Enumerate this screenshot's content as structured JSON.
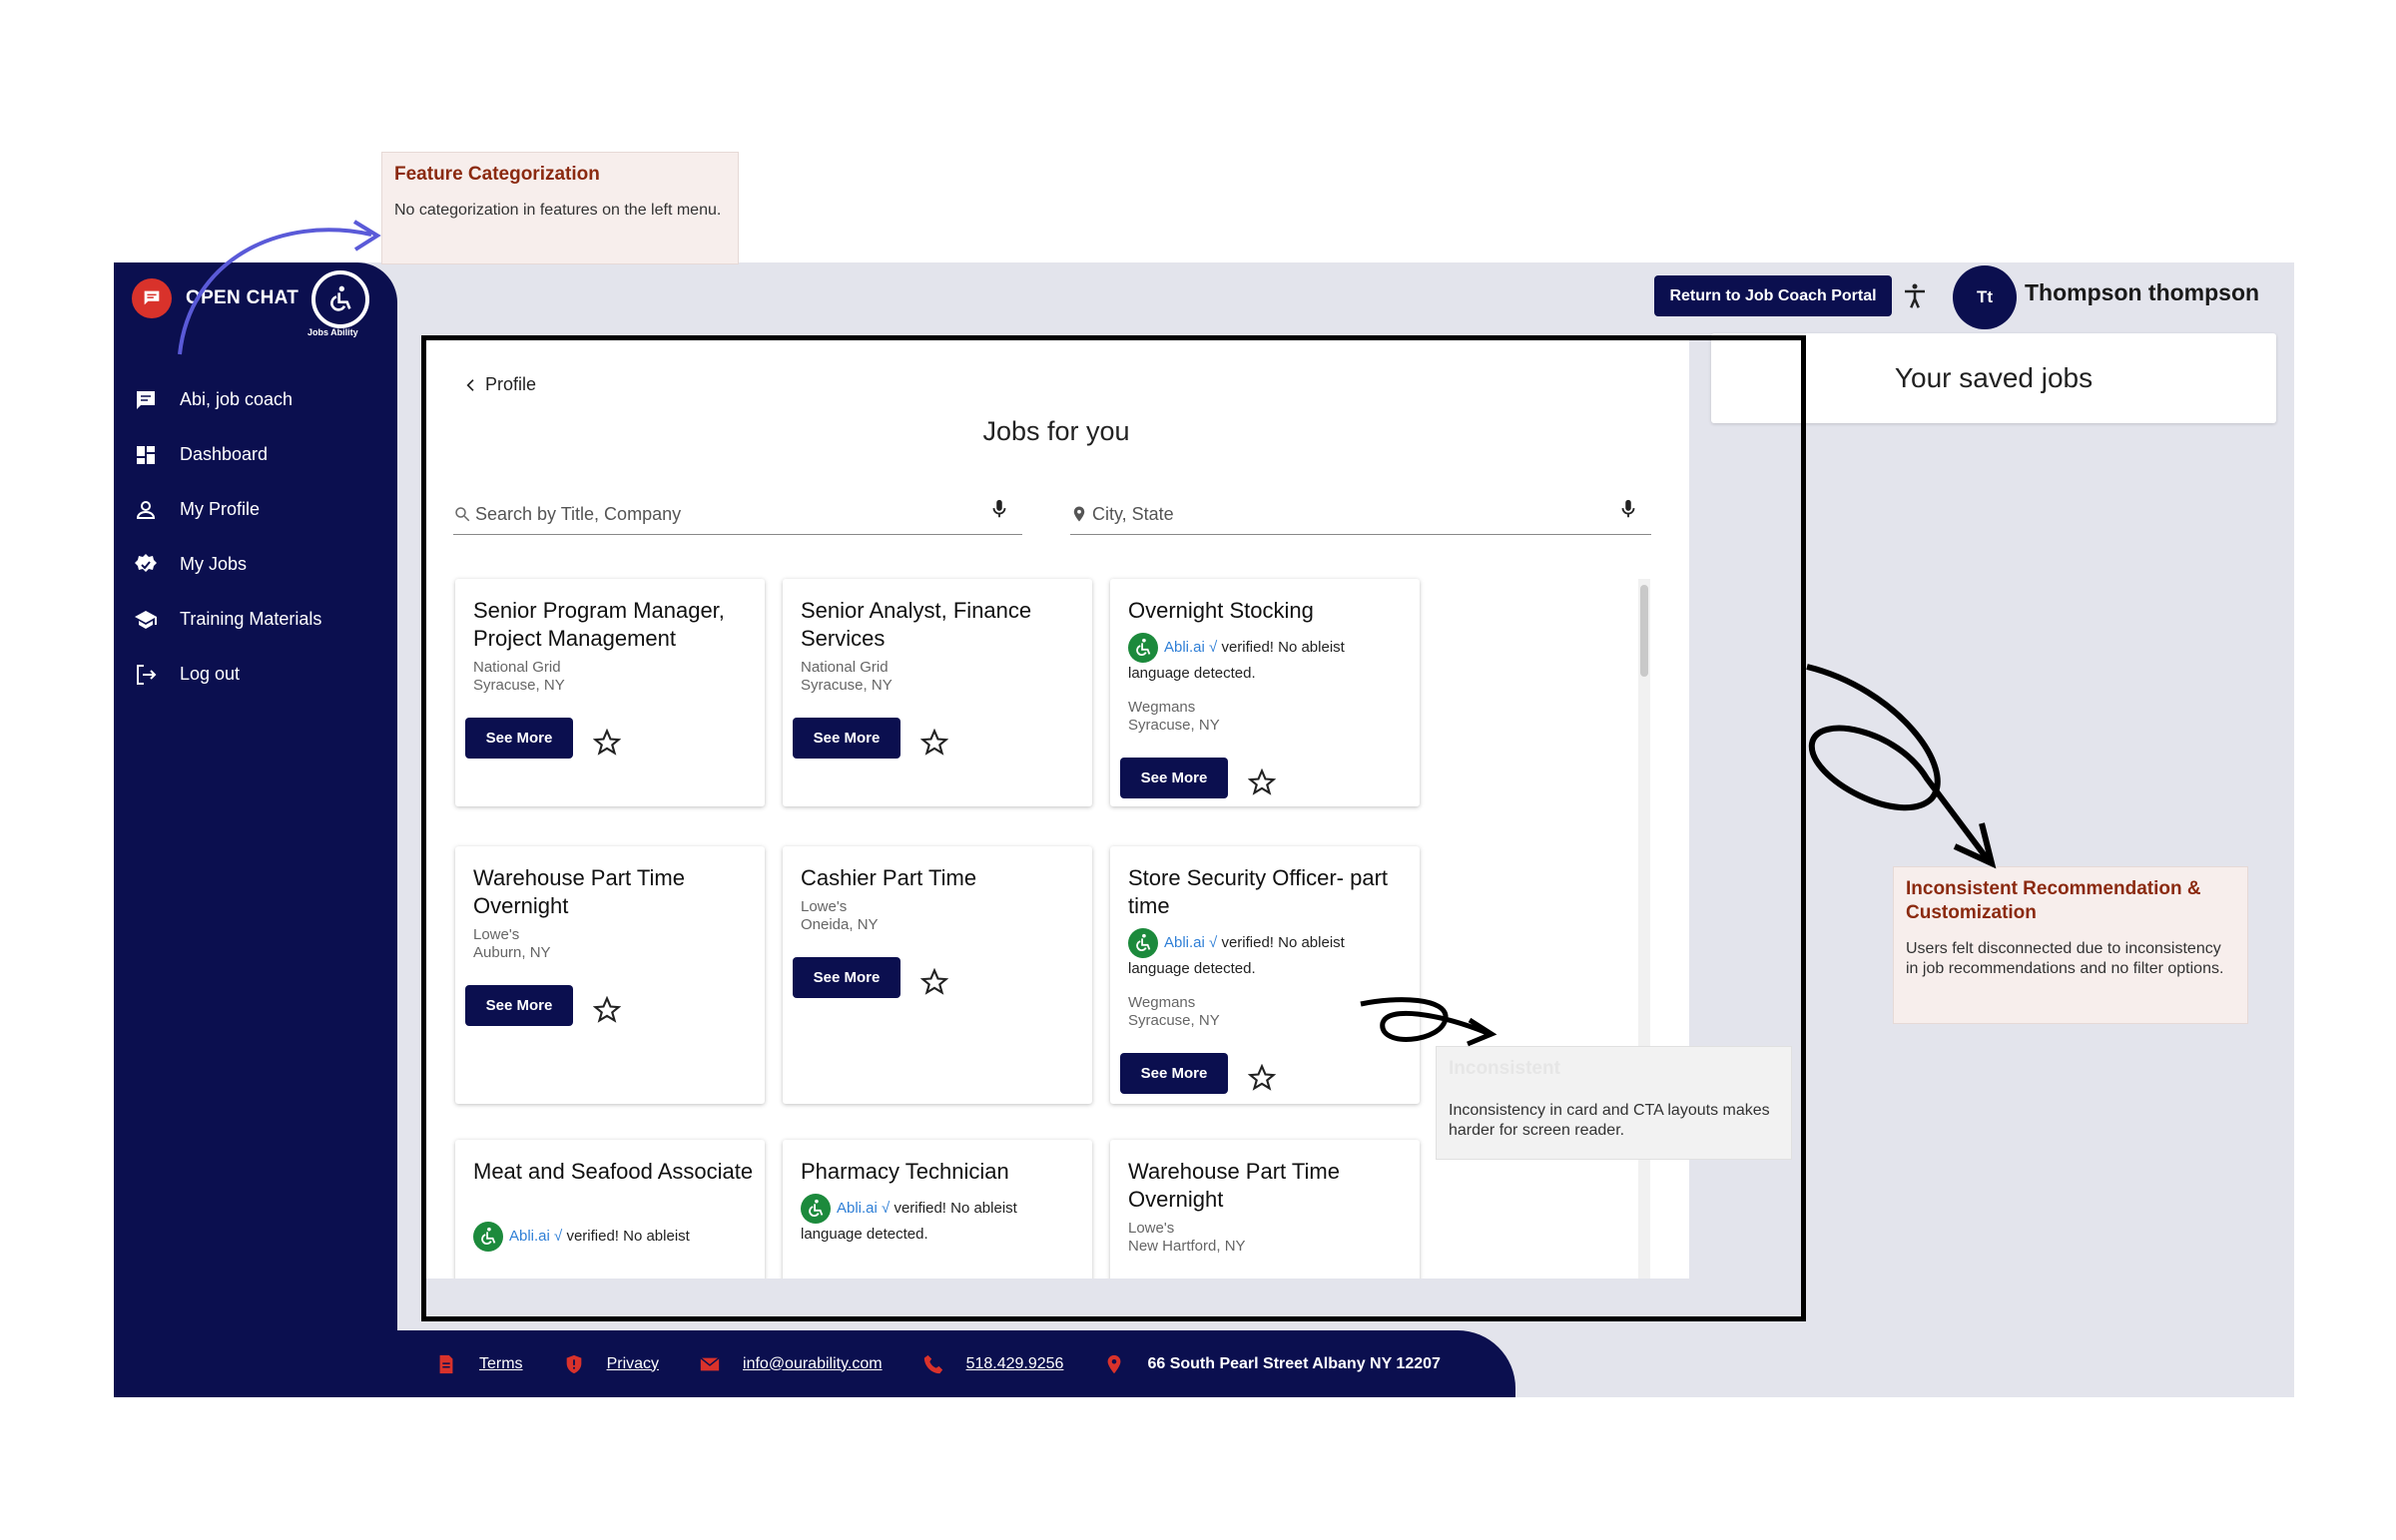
{
  "sidebar": {
    "open_chat": "OPEN CHAT",
    "logo_text": "Jobs Ability",
    "items": [
      {
        "label": "Abi, job coach",
        "icon": "chat-icon"
      },
      {
        "label": "Dashboard",
        "icon": "dashboard-icon"
      },
      {
        "label": "My Profile",
        "icon": "person-icon"
      },
      {
        "label": "My Jobs",
        "icon": "verified-icon"
      },
      {
        "label": "Training Materials",
        "icon": "school-icon"
      },
      {
        "label": "Log out",
        "icon": "logout-icon"
      }
    ]
  },
  "header": {
    "return_label": "Return to Job Coach Portal",
    "avatar_initials": "Tt",
    "username": "Thompson thompson"
  },
  "main": {
    "back_label": "Profile",
    "title": "Jobs for you",
    "search_placeholder": "Search by Title, Company",
    "location_placeholder": "City, State"
  },
  "saved": {
    "title": "Your saved jobs"
  },
  "cta_label": "See More",
  "abli": {
    "name": "Abli.ai",
    "check": "√",
    "text": "verified! No ableist language detected."
  },
  "jobs": [
    {
      "title": "Senior Program Manager, Project Management",
      "company": "National Grid",
      "location": "Syracuse, NY"
    },
    {
      "title": "Senior Analyst, Finance Services",
      "company": "National Grid",
      "location": "Syracuse, NY"
    },
    {
      "title": "Overnight Stocking",
      "company": "Wegmans",
      "location": "Syracuse, NY",
      "verified": true
    },
    {
      "title": "Warehouse Part Time Overnight",
      "company": "Lowe's",
      "location": "Auburn, NY"
    },
    {
      "title": "Cashier Part Time",
      "company": "Lowe's",
      "location": "Oneida, NY"
    },
    {
      "title": "Store Security Officer- part time",
      "company": "Wegmans",
      "location": "Syracuse, NY",
      "verified": true
    },
    {
      "title": "Meat and Seafood Associate",
      "abli_line": "verified! No ableist",
      "verified": true
    },
    {
      "title": "Pharmacy Technician",
      "verified": true
    },
    {
      "title": "Warehouse Part Time Overnight",
      "company": "Lowe's",
      "location": "New Hartford, NY"
    }
  ],
  "footer": {
    "terms": "Terms",
    "privacy": "Privacy",
    "email": "info@ourability.com",
    "phone": "518.429.9256",
    "address": "66 South Pearl Street Albany NY 12207"
  },
  "annotations": {
    "feature": {
      "title": "Feature Categorization",
      "body": "No categorization in features on the left menu."
    },
    "recommendation": {
      "title": "Inconsistent  Recommendation & Customization",
      "body": "Users felt disconnected due to inconsistency in job recommendations and no filter options."
    },
    "inconsistent": {
      "title": "Inconsistent",
      "body": "Inconsistency in card and CTA layouts makes harder for screen reader."
    }
  },
  "colors": {
    "navy": "#0b0f4f",
    "red": "#d9322b",
    "green": "#1c8a3c",
    "annotation_title": "#8b2a10"
  }
}
